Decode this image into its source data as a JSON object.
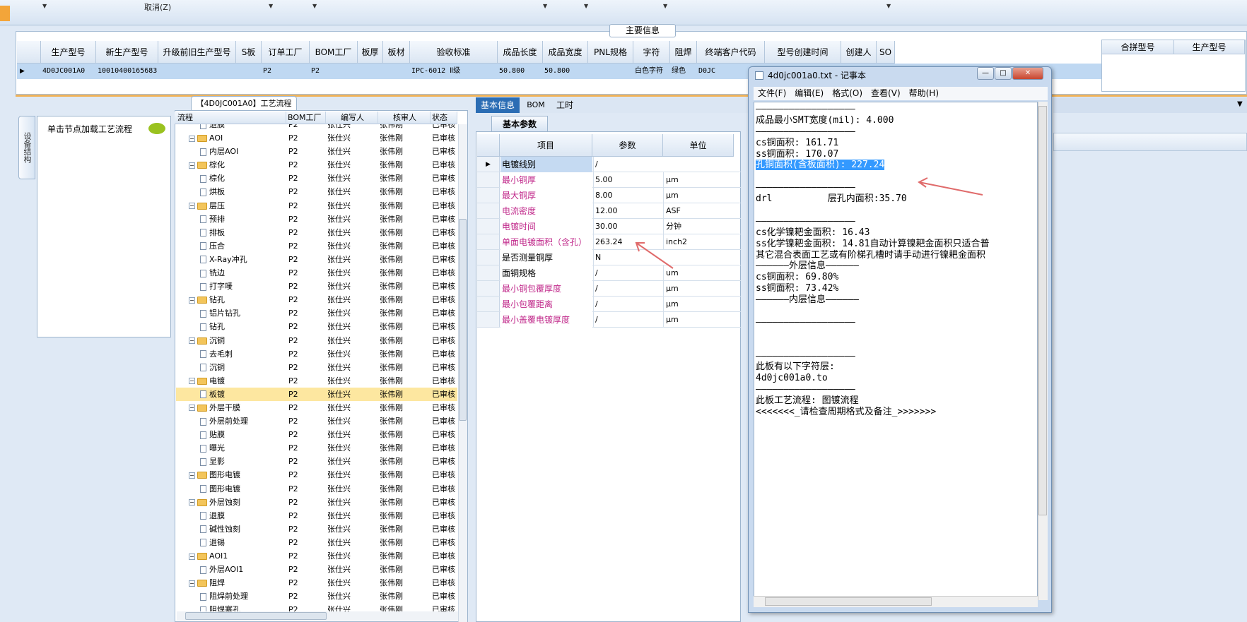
{
  "toolbar": {
    "cancel_label": "取消(Z)"
  },
  "main_info": {
    "title": "主要信息",
    "columns": [
      "生产型号",
      "新生产型号",
      "升级前旧生产型号",
      "S板",
      "订单工厂",
      "BOM工厂",
      "板厚",
      "板材",
      "验收标准",
      "成品长度",
      "成品宽度",
      "PNL规格",
      "字符",
      "阻焊",
      "终端客户代码",
      "型号创建时间",
      "创建人",
      "SO"
    ],
    "row": [
      "4D0JC001A0",
      "10010400165683",
      "",
      "",
      "P2",
      "P2",
      "",
      "",
      "IPC-6012 Ⅱ级",
      "50.800",
      "50.800",
      "",
      "白色字符",
      "绿色",
      "D0JC",
      "",
      "",
      ""
    ],
    "right_columns": [
      "合拼型号",
      "生产型号"
    ]
  },
  "left_panel": {
    "tab_label": "设备结构",
    "hint": "单击节点加载工艺流程"
  },
  "flow_tab": {
    "label": "【4D0JC001A0】工艺流程"
  },
  "tree": {
    "columns": [
      "流程",
      "BOM工厂",
      "编写人",
      "核审人",
      "状态"
    ],
    "rows": [
      {
        "level": 2,
        "name": "退膜",
        "factory": "P2",
        "writer": "张仕兴",
        "reviewer": "张伟刚",
        "status": "已审核",
        "folder": false
      },
      {
        "level": 1,
        "name": "AOI",
        "factory": "P2",
        "writer": "张仕兴",
        "reviewer": "张伟刚",
        "status": "已审核",
        "folder": true
      },
      {
        "level": 2,
        "name": "内层AOI",
        "factory": "P2",
        "writer": "张仕兴",
        "reviewer": "张伟刚",
        "status": "已审核",
        "folder": false
      },
      {
        "level": 1,
        "name": "棕化",
        "factory": "P2",
        "writer": "张仕兴",
        "reviewer": "张伟刚",
        "status": "已审核",
        "folder": true
      },
      {
        "level": 2,
        "name": "棕化",
        "factory": "P2",
        "writer": "张仕兴",
        "reviewer": "张伟刚",
        "status": "已审核",
        "folder": false
      },
      {
        "level": 2,
        "name": "烘板",
        "factory": "P2",
        "writer": "张仕兴",
        "reviewer": "张伟刚",
        "status": "已审核",
        "folder": false
      },
      {
        "level": 1,
        "name": "层压",
        "factory": "P2",
        "writer": "张仕兴",
        "reviewer": "张伟刚",
        "status": "已审核",
        "folder": true
      },
      {
        "level": 2,
        "name": "预排",
        "factory": "P2",
        "writer": "张仕兴",
        "reviewer": "张伟刚",
        "status": "已审核",
        "folder": false
      },
      {
        "level": 2,
        "name": "排板",
        "factory": "P2",
        "writer": "张仕兴",
        "reviewer": "张伟刚",
        "status": "已审核",
        "folder": false
      },
      {
        "level": 2,
        "name": "压合",
        "factory": "P2",
        "writer": "张仕兴",
        "reviewer": "张伟刚",
        "status": "已审核",
        "folder": false
      },
      {
        "level": 2,
        "name": "X-Ray冲孔",
        "factory": "P2",
        "writer": "张仕兴",
        "reviewer": "张伟刚",
        "status": "已审核",
        "folder": false
      },
      {
        "level": 2,
        "name": "铣边",
        "factory": "P2",
        "writer": "张仕兴",
        "reviewer": "张伟刚",
        "status": "已审核",
        "folder": false
      },
      {
        "level": 2,
        "name": "打字唛",
        "factory": "P2",
        "writer": "张仕兴",
        "reviewer": "张伟刚",
        "status": "已审核",
        "folder": false
      },
      {
        "level": 1,
        "name": "钻孔",
        "factory": "P2",
        "writer": "张仕兴",
        "reviewer": "张伟刚",
        "status": "已审核",
        "folder": true
      },
      {
        "level": 2,
        "name": "铝片钻孔",
        "factory": "P2",
        "writer": "张仕兴",
        "reviewer": "张伟刚",
        "status": "已审核",
        "folder": false
      },
      {
        "level": 2,
        "name": "钻孔",
        "factory": "P2",
        "writer": "张仕兴",
        "reviewer": "张伟刚",
        "status": "已审核",
        "folder": false
      },
      {
        "level": 1,
        "name": "沉铜",
        "factory": "P2",
        "writer": "张仕兴",
        "reviewer": "张伟刚",
        "status": "已审核",
        "folder": true
      },
      {
        "level": 2,
        "name": "去毛刺",
        "factory": "P2",
        "writer": "张仕兴",
        "reviewer": "张伟刚",
        "status": "已审核",
        "folder": false
      },
      {
        "level": 2,
        "name": "沉铜",
        "factory": "P2",
        "writer": "张仕兴",
        "reviewer": "张伟刚",
        "status": "已审核",
        "folder": false
      },
      {
        "level": 1,
        "name": "电镀",
        "factory": "P2",
        "writer": "张仕兴",
        "reviewer": "张伟刚",
        "status": "已审核",
        "folder": true
      },
      {
        "level": 2,
        "name": "板镀",
        "factory": "P2",
        "writer": "张仕兴",
        "reviewer": "张伟刚",
        "status": "已审核",
        "folder": false,
        "selected": true
      },
      {
        "level": 1,
        "name": "外层干膜",
        "factory": "P2",
        "writer": "张仕兴",
        "reviewer": "张伟刚",
        "status": "已审核",
        "folder": true
      },
      {
        "level": 2,
        "name": "外层前处理",
        "factory": "P2",
        "writer": "张仕兴",
        "reviewer": "张伟刚",
        "status": "已审核",
        "folder": false
      },
      {
        "level": 2,
        "name": "贴膜",
        "factory": "P2",
        "writer": "张仕兴",
        "reviewer": "张伟刚",
        "status": "已审核",
        "folder": false
      },
      {
        "level": 2,
        "name": "曝光",
        "factory": "P2",
        "writer": "张仕兴",
        "reviewer": "张伟刚",
        "status": "已审核",
        "folder": false
      },
      {
        "level": 2,
        "name": "显影",
        "factory": "P2",
        "writer": "张仕兴",
        "reviewer": "张伟刚",
        "status": "已审核",
        "folder": false
      },
      {
        "level": 1,
        "name": "图形电镀",
        "factory": "P2",
        "writer": "张仕兴",
        "reviewer": "张伟刚",
        "status": "已审核",
        "folder": true
      },
      {
        "level": 2,
        "name": "图形电镀",
        "factory": "P2",
        "writer": "张仕兴",
        "reviewer": "张伟刚",
        "status": "已审核",
        "folder": false
      },
      {
        "level": 1,
        "name": "外层蚀刻",
        "factory": "P2",
        "writer": "张仕兴",
        "reviewer": "张伟刚",
        "status": "已审核",
        "folder": true
      },
      {
        "level": 2,
        "name": "退膜",
        "factory": "P2",
        "writer": "张仕兴",
        "reviewer": "张伟刚",
        "status": "已审核",
        "folder": false
      },
      {
        "level": 2,
        "name": "碱性蚀刻",
        "factory": "P2",
        "writer": "张仕兴",
        "reviewer": "张伟刚",
        "status": "已审核",
        "folder": false
      },
      {
        "level": 2,
        "name": "退锡",
        "factory": "P2",
        "writer": "张仕兴",
        "reviewer": "张伟刚",
        "status": "已审核",
        "folder": false
      },
      {
        "level": 1,
        "name": "AOI1",
        "factory": "P2",
        "writer": "张仕兴",
        "reviewer": "张伟刚",
        "status": "已审核",
        "folder": true
      },
      {
        "level": 2,
        "name": "外层AOI1",
        "factory": "P2",
        "writer": "张仕兴",
        "reviewer": "张伟刚",
        "status": "已审核",
        "folder": false
      },
      {
        "level": 1,
        "name": "阻焊",
        "factory": "P2",
        "writer": "张仕兴",
        "reviewer": "张伟刚",
        "status": "已审核",
        "folder": true
      },
      {
        "level": 2,
        "name": "阻焊前处理",
        "factory": "P2",
        "writer": "张仕兴",
        "reviewer": "张伟刚",
        "status": "已审核",
        "folder": false
      },
      {
        "level": 2,
        "name": "阻焊塞孔",
        "factory": "P2",
        "writer": "张仕兴",
        "reviewer": "张伟刚",
        "status": "已审核",
        "folder": false
      }
    ]
  },
  "detail_tabs": [
    "基本信息",
    "BOM",
    "工时"
  ],
  "sub_tab": "基本参数",
  "params": {
    "columns": [
      "项目",
      "参数",
      "单位"
    ],
    "rows": [
      {
        "item": "电镀线别",
        "value": "/",
        "unit": "",
        "red": false
      },
      {
        "item": "最小铜厚",
        "value": "5.00",
        "unit": "μm",
        "red": true
      },
      {
        "item": "最大铜厚",
        "value": "8.00",
        "unit": "μm",
        "red": true
      },
      {
        "item": "电流密度",
        "value": "12.00",
        "unit": "ASF",
        "red": true
      },
      {
        "item": "电镀时间",
        "value": "30.00",
        "unit": "分钟",
        "red": true
      },
      {
        "item": "单面电镀面积（含孔）",
        "value": "263.24",
        "unit": "inch2",
        "red": true
      },
      {
        "item": "是否测量铜厚",
        "value": "N",
        "unit": "",
        "red": false
      },
      {
        "item": "面铜规格",
        "value": "/",
        "unit": "um",
        "red": false
      },
      {
        "item": "最小铜包覆厚度",
        "value": "/",
        "unit": "μm",
        "red": true
      },
      {
        "item": "最小包覆距离",
        "value": "/",
        "unit": "μm",
        "red": true
      },
      {
        "item": "最小盖覆电镀厚度",
        "value": "/",
        "unit": "μm",
        "red": true
      }
    ]
  },
  "notepad": {
    "title": "4d0jc001a0.txt - 记事本",
    "menu": [
      "文件(F)",
      "编辑(E)",
      "格式(O)",
      "查看(V)",
      "帮助(H)"
    ],
    "lines": [
      "——————————————————",
      "成品最小SMT宽度(mil): 4.000",
      "——————————————————",
      "cs铜面积: 161.71",
      "ss铜面积: 170.07",
      "孔铜面积(含板面积): 227.24",
      "",
      "——————————————————",
      "drl          层孔内面积:35.70",
      "",
      "——————————————————",
      "cs化学镍耙金面积: 16.43",
      "ss化学镍耙金面积: 14.81自动计算镍耙金面积只适合普",
      "其它混合表面工艺或有阶梯孔槽时请手动进行镍耙金面积",
      "——————外层信息——————",
      "cs铜面积: 69.80%",
      "ss铜面积: 73.42%",
      "——————内层信息——————",
      "",
      "——————————————————",
      "",
      "",
      "——————————————————",
      "此板有以下字符层:",
      "4d0jc001a0.to",
      "——————————————————",
      "此板工艺流程: 图镀流程",
      "<<<<<<<_请检查周期格式及备注_>>>>>>>"
    ],
    "highlight_line": 5
  }
}
